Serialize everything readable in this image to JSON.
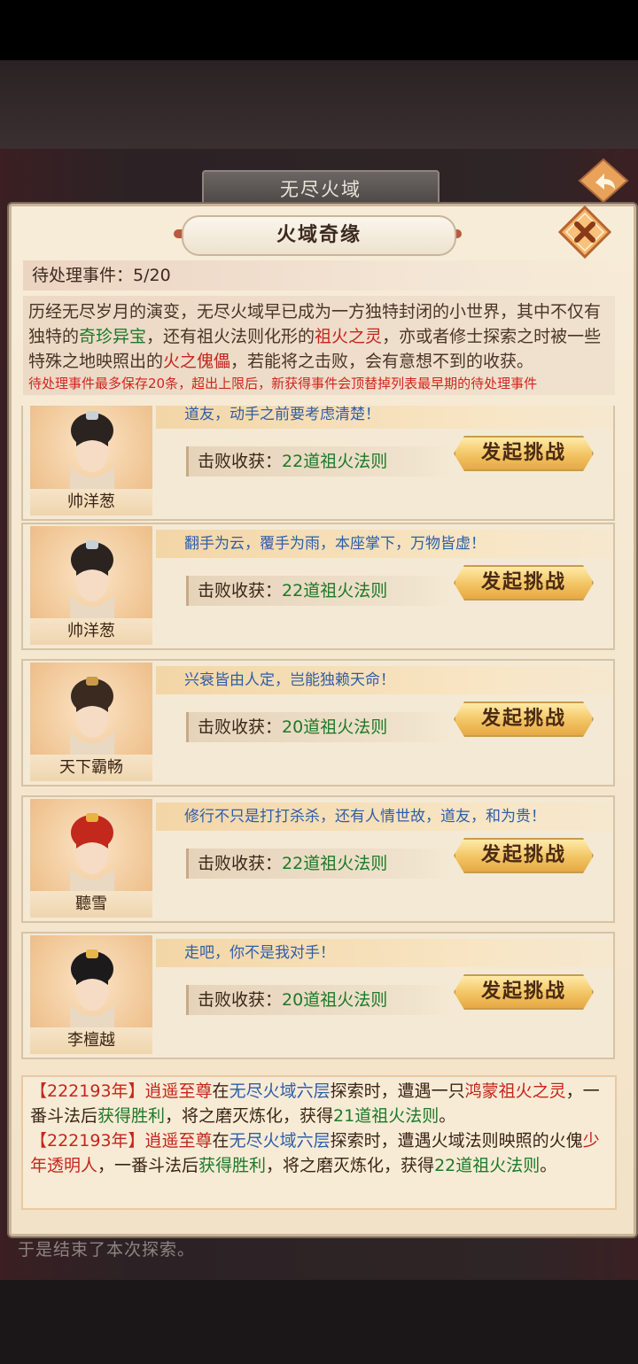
{
  "outer": {
    "title": "无尽火域",
    "bottom_text": "于是结束了本次探索。"
  },
  "panel": {
    "title": "火域奇缘",
    "pending_label": "待处理事件：",
    "pending_value": "5/20",
    "desc": {
      "p1": "历经无尽岁月的演变，无尽火域早已成为一方独特封闭的小世界，其中不仅有独特的",
      "hl1": "奇珍异宝",
      "p2": "，还有祖火法则化形的",
      "hl2": "祖火之灵",
      "p3": "，亦或者修士探索之时被一些特殊之地映照出的",
      "hl3": "火之傀儡",
      "p4": "，若能将之击败，会有意想不到的收获。",
      "warning": "待处理事件最多保存20条，超出上限后，新获得事件会顶替掉列表最早期的待处理事件"
    }
  },
  "events": [
    {
      "name": "帅洋葱",
      "quote": "道友，动手之前要考虑清楚！",
      "reward_label": "击败收获：",
      "reward_value": "22道祖火法则",
      "button": "发起挑战",
      "hair": "#2b2320",
      "accent": "#c7d0d8"
    },
    {
      "name": "帅洋葱",
      "quote": "翻手为云，覆手为雨，本座掌下，万物皆虚！",
      "reward_label": "击败收获：",
      "reward_value": "22道祖火法则",
      "button": "发起挑战",
      "hair": "#2b2320",
      "accent": "#c7d0d8"
    },
    {
      "name": "天下霸畅",
      "quote": "兴衰皆由人定，岂能独赖天命！",
      "reward_label": "击败收获：",
      "reward_value": "20道祖火法则",
      "button": "发起挑战",
      "hair": "#3a2a20",
      "accent": "#c99a4a"
    },
    {
      "name": "聽雪",
      "quote": "修行不只是打打杀杀，还有人情世故，道友，和为贵！",
      "reward_label": "击败收获：",
      "reward_value": "22道祖火法则",
      "button": "发起挑战",
      "hair": "#c2281c",
      "accent": "#e8b341"
    },
    {
      "name": "李檀越",
      "quote": "走吧，你不是我对手！",
      "reward_label": "击败收获：",
      "reward_value": "20道祖火法则",
      "button": "发起挑战",
      "hair": "#1d1a1c",
      "accent": "#e6b64a"
    }
  ],
  "log": [
    {
      "year": "【222193年】",
      "who": "逍遥至尊",
      "in": "在",
      "place": "无尽火域六层",
      "mid": "探索时，遭遇一只",
      "target": "鸿蒙祖火之灵",
      "mid2": "，一番斗法后",
      "result": "获得胜利",
      "end1": "，将之磨灭炼化，获得",
      "gain": "21道祖火法则",
      "end2": "。"
    },
    {
      "year": "【222193年】",
      "who": "逍遥至尊",
      "in": "在",
      "place": "无尽火域六层",
      "mid": "探索时，遭遇火域法则映照的火傀",
      "target": "少年透明人",
      "mid2": "，一番斗法后",
      "result": "获得胜利",
      "end1": "，将之磨灭炼化，获得",
      "gain": "22道祖火法则",
      "end2": "。"
    }
  ]
}
